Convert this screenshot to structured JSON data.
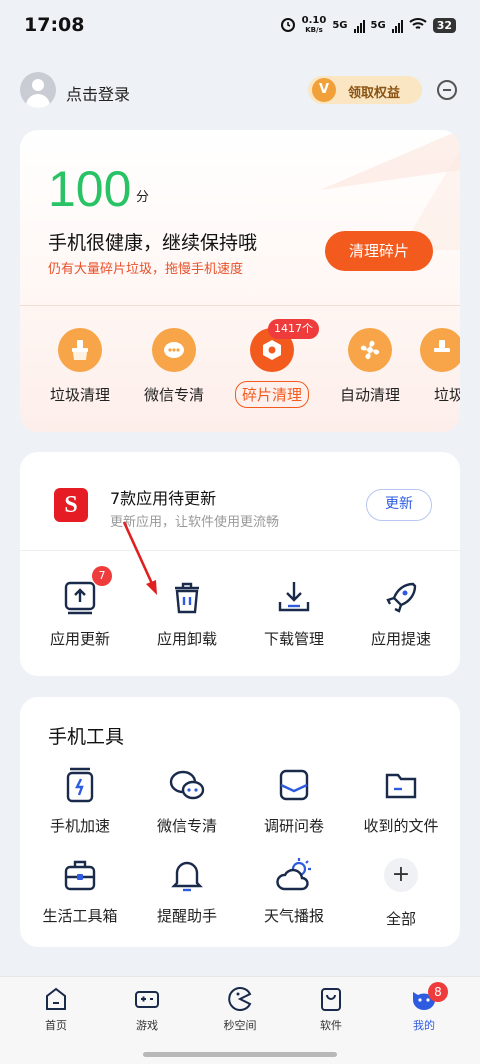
{
  "status_bar": {
    "time": "17:08",
    "net_speed": "0.10",
    "net_unit": "KB/s",
    "sim1": "5G",
    "sim2": "5G",
    "battery": "32"
  },
  "header": {
    "login_text": "点击登录",
    "vip_badge": "V",
    "vip_text": "领取权益"
  },
  "score_card": {
    "score": "100",
    "score_unit": "分",
    "title": "手机很健康，继续保持哦",
    "subtitle": "仍有大量碎片垃圾，拖慢手机速度",
    "clean_button": "清理碎片",
    "quick_items": [
      {
        "label": "垃圾清理",
        "icon": "broom-icon"
      },
      {
        "label": "微信专清",
        "icon": "wechat-icon"
      },
      {
        "label": "碎片清理",
        "icon": "fragment-icon",
        "badge": "1417个",
        "active": true
      },
      {
        "label": "自动清理",
        "icon": "fan-icon"
      },
      {
        "label": "垃圾清理",
        "icon": "broom-icon"
      }
    ]
  },
  "update_card": {
    "logo_text": "S",
    "title": "7款应用待更新",
    "subtitle": "更新应用，让软件使用更流畅",
    "update_button": "更新",
    "items": [
      {
        "label": "应用更新",
        "icon": "app-update-icon",
        "badge": "7"
      },
      {
        "label": "应用卸载",
        "icon": "trash-icon"
      },
      {
        "label": "下载管理",
        "icon": "download-icon"
      },
      {
        "label": "应用提速",
        "icon": "rocket-icon"
      }
    ]
  },
  "tools_card": {
    "title": "手机工具",
    "items": [
      {
        "label": "手机加速",
        "icon": "phone-boost-icon"
      },
      {
        "label": "微信专清",
        "icon": "wechat-icon"
      },
      {
        "label": "调研问卷",
        "icon": "survey-icon"
      },
      {
        "label": "收到的文件",
        "icon": "folder-icon"
      },
      {
        "label": "生活工具箱",
        "icon": "toolbox-icon"
      },
      {
        "label": "提醒助手",
        "icon": "bell-icon"
      },
      {
        "label": "天气播报",
        "icon": "weather-icon"
      },
      {
        "label": "全部",
        "icon": "plus-icon",
        "glyph": "+"
      }
    ]
  },
  "bottom_nav": {
    "items": [
      {
        "label": "首页",
        "icon": "home-icon"
      },
      {
        "label": "游戏",
        "icon": "gamepad-icon"
      },
      {
        "label": "秒空间",
        "icon": "pacman-icon"
      },
      {
        "label": "软件",
        "icon": "bag-icon"
      },
      {
        "label": "我的",
        "icon": "profile-icon",
        "badge": "8",
        "active": true
      }
    ]
  },
  "colors": {
    "score_green": "#29c264",
    "accent_orange": "#f35a1e",
    "link_blue": "#2f5be0",
    "badge_red": "#ee3b3b"
  }
}
